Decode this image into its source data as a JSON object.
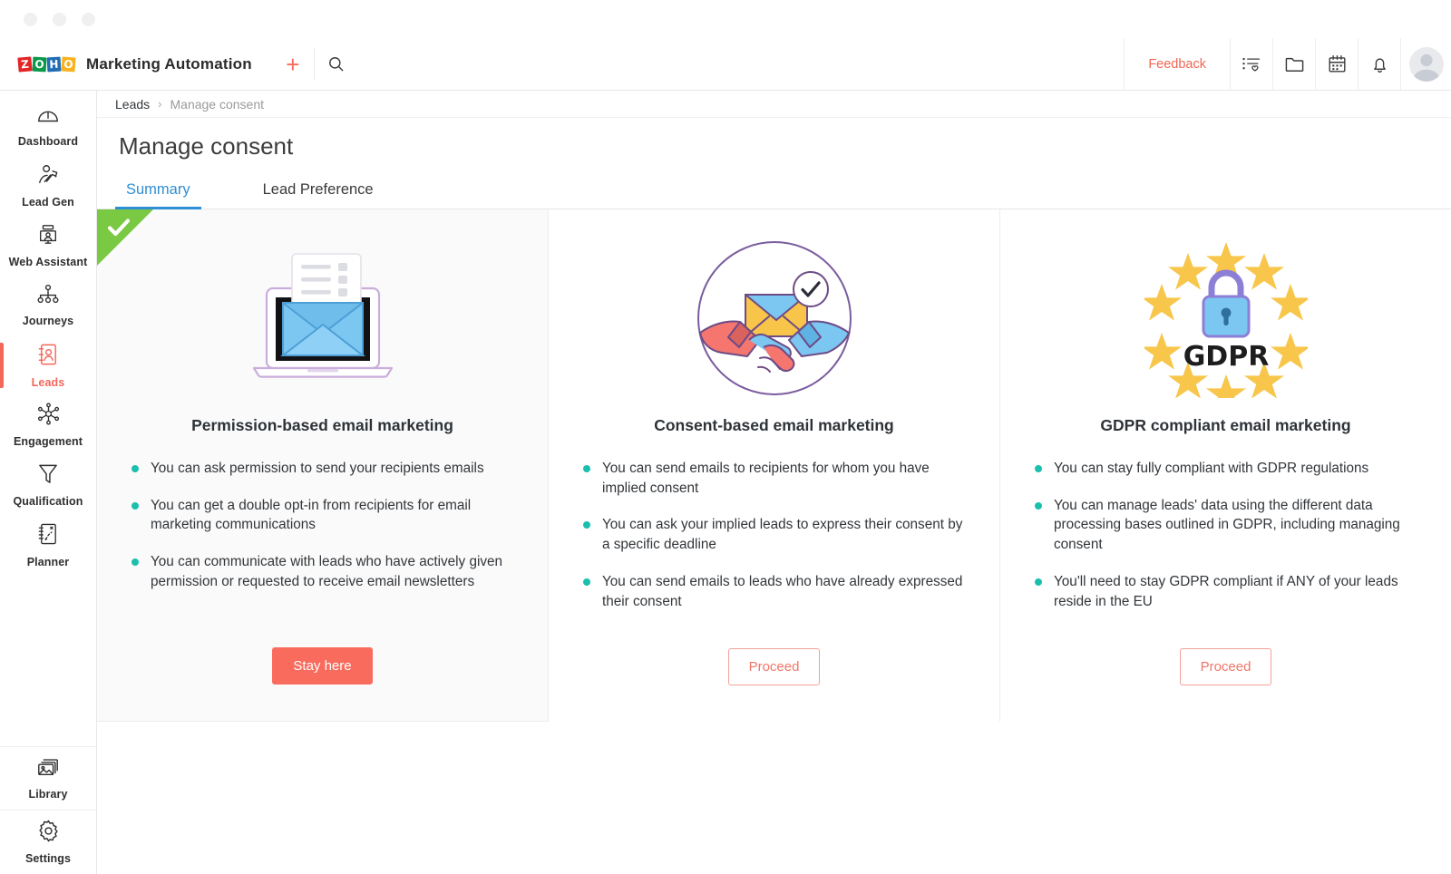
{
  "window": {
    "dots": [
      "window-close",
      "window-minimize",
      "window-zoom"
    ]
  },
  "topbar": {
    "brand": {
      "logo_letters": [
        "Z",
        "O",
        "H",
        "O"
      ],
      "title": "Marketing Automation"
    },
    "add_label": "+",
    "search_icon": "search-icon",
    "feedback_label": "Feedback",
    "icons": [
      "list-heart-icon",
      "folder-icon",
      "calendar-icon",
      "bell-icon",
      "avatar-icon"
    ]
  },
  "sidebar": {
    "items": [
      {
        "label": "Dashboard",
        "icon": "gauge-icon",
        "active": false
      },
      {
        "label": "Lead Gen",
        "icon": "person-growth-icon",
        "active": false
      },
      {
        "label": "Web Assistant",
        "icon": "web-assistant-icon",
        "active": false
      },
      {
        "label": "Journeys",
        "icon": "journeys-icon",
        "active": false
      },
      {
        "label": "Leads",
        "icon": "leads-icon",
        "active": true
      },
      {
        "label": "Engagement",
        "icon": "engagement-icon",
        "active": false
      },
      {
        "label": "Qualification",
        "icon": "funnel-icon",
        "active": false
      },
      {
        "label": "Planner",
        "icon": "planner-icon",
        "active": false
      }
    ],
    "bottom_items": [
      {
        "label": "Library",
        "icon": "library-icon"
      },
      {
        "label": "Settings",
        "icon": "gear-icon"
      }
    ]
  },
  "breadcrumb": {
    "parent": "Leads",
    "separator": "›",
    "current": "Manage consent"
  },
  "page": {
    "title": "Manage consent"
  },
  "tabs": [
    {
      "label": "Summary",
      "active": true
    },
    {
      "label": "Lead Preference",
      "active": false
    }
  ],
  "cards": [
    {
      "selected": true,
      "illustration": "laptop-envelope-document-illustration",
      "title": "Permission-based email marketing",
      "bullets": [
        "You can ask permission to send your recipients emails",
        "You can get a double opt-in from recipients for email marketing communications",
        "You can communicate with leads who have actively given permission or requested to receive email newsletters"
      ],
      "button": {
        "label": "Stay here",
        "style": "primary"
      }
    },
    {
      "selected": false,
      "illustration": "handshake-envelope-check-illustration",
      "title": "Consent-based email marketing",
      "bullets": [
        "You can send emails to recipients for whom you have implied consent",
        "You can ask your implied leads to express their consent by a specific deadline",
        "You can send emails to leads who have already expressed their consent"
      ],
      "button": {
        "label": "Proceed",
        "style": "outline"
      }
    },
    {
      "selected": false,
      "illustration": "gdpr-padlock-eu-stars-illustration",
      "title": "GDPR compliant email marketing",
      "bullets": [
        "You can stay fully compliant with GDPR regulations",
        "You can manage leads' data using the different data processing bases outlined in GDPR, including managing consent",
        "You'll need to stay GDPR compliant if ANY of your leads reside in the EU"
      ],
      "button": {
        "label": "Proceed",
        "style": "outline"
      },
      "gdpr_label": "GDPR"
    }
  ],
  "colors": {
    "accent_red": "#f96b5d",
    "tab_blue": "#2f8fd4",
    "bullet_teal": "#1bbfae",
    "ribbon_green": "#7ac943"
  }
}
